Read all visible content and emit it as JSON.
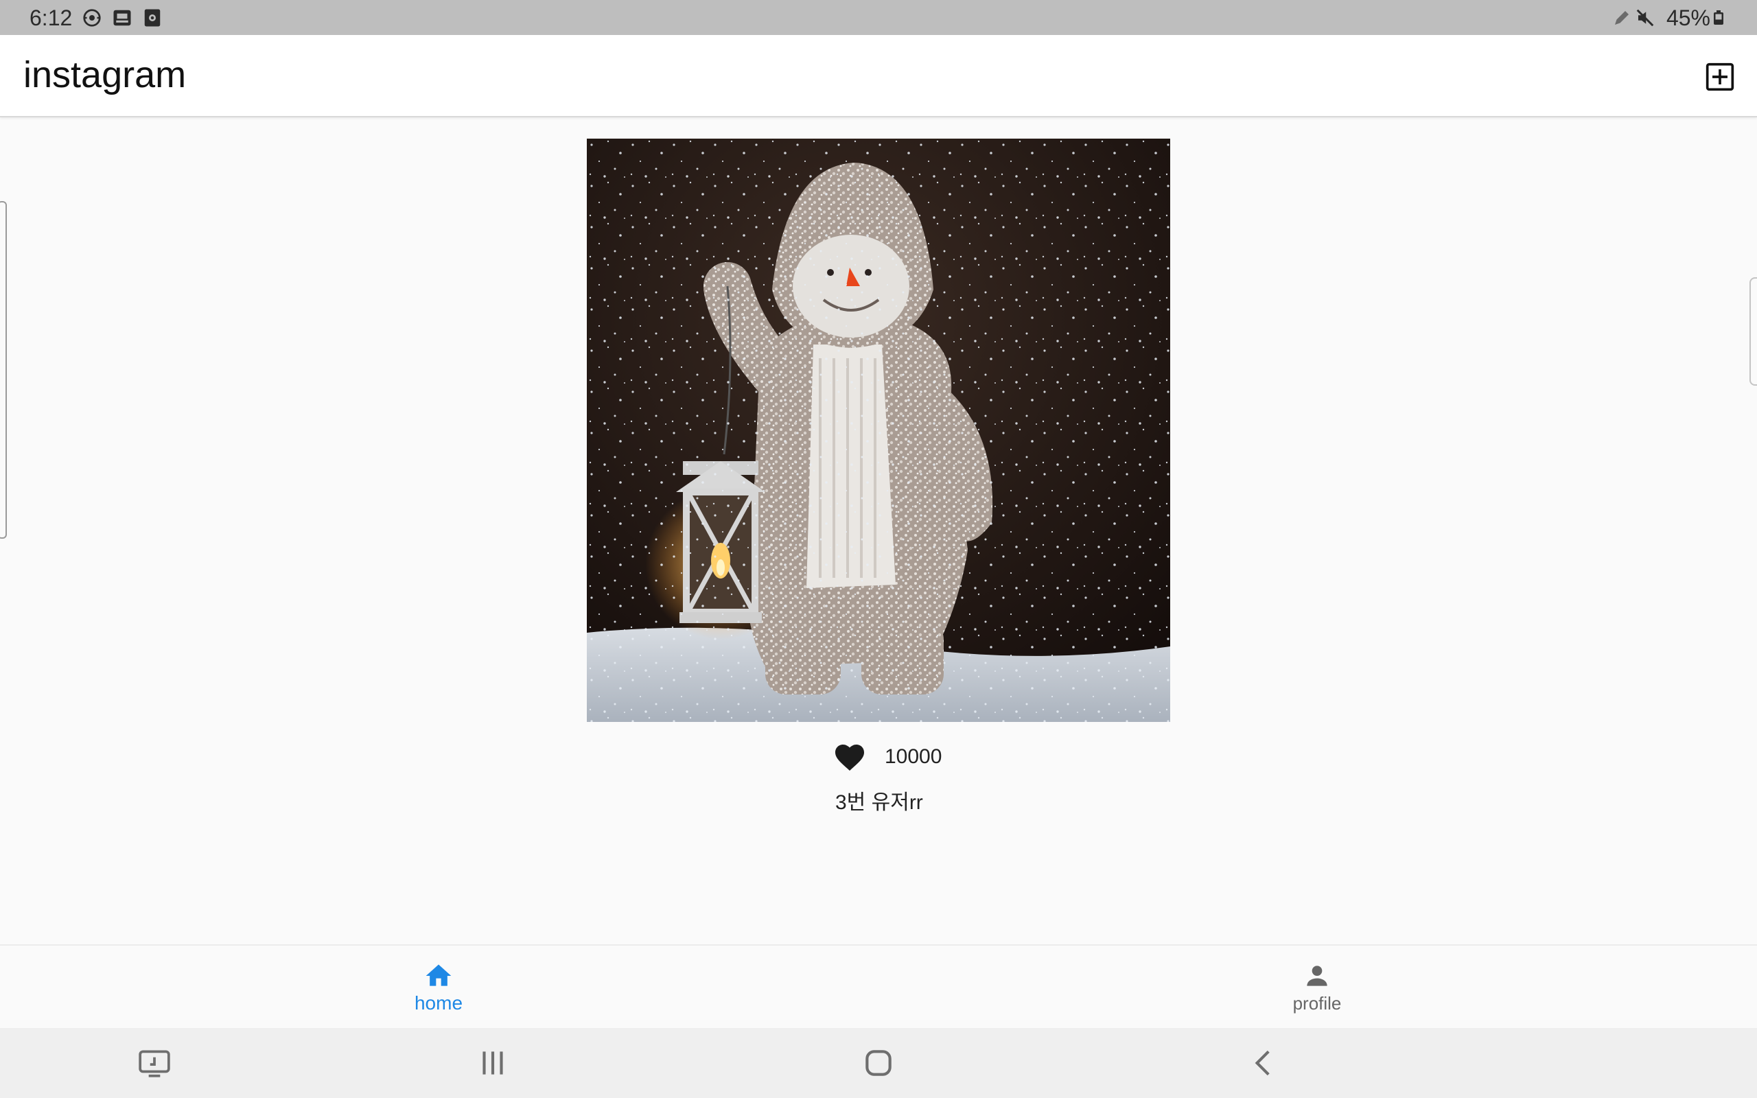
{
  "status_bar": {
    "time": "6:12",
    "battery": "45%"
  },
  "app_bar": {
    "title": "instagram"
  },
  "post": {
    "image_alt": "Snowman figurine in a hooded coat holding a lit lantern in falling snow",
    "like_count": "10000",
    "caption": "3번 유저rr"
  },
  "bottom_nav": {
    "items": [
      {
        "label": "home",
        "icon": "home-icon",
        "active": true
      },
      {
        "label": "profile",
        "icon": "person-icon",
        "active": false
      }
    ]
  },
  "colors": {
    "accent": "#1e88e5",
    "status_bar_bg": "#bebebe",
    "app_bar_bg": "#ffffff",
    "page_bg": "#fafafa",
    "system_nav_bg": "#efefef"
  }
}
